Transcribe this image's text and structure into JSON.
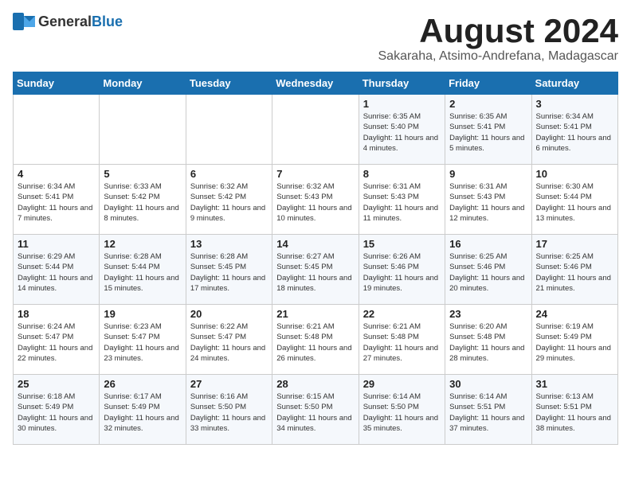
{
  "header": {
    "logo_general": "General",
    "logo_blue": "Blue",
    "title": "August 2024",
    "subtitle": "Sakaraha, Atsimo-Andrefana, Madagascar"
  },
  "days_of_week": [
    "Sunday",
    "Monday",
    "Tuesday",
    "Wednesday",
    "Thursday",
    "Friday",
    "Saturday"
  ],
  "weeks": [
    [
      {
        "day": "",
        "info": ""
      },
      {
        "day": "",
        "info": ""
      },
      {
        "day": "",
        "info": ""
      },
      {
        "day": "",
        "info": ""
      },
      {
        "day": "1",
        "info": "Sunrise: 6:35 AM\nSunset: 5:40 PM\nDaylight: 11 hours and 4 minutes."
      },
      {
        "day": "2",
        "info": "Sunrise: 6:35 AM\nSunset: 5:41 PM\nDaylight: 11 hours and 5 minutes."
      },
      {
        "day": "3",
        "info": "Sunrise: 6:34 AM\nSunset: 5:41 PM\nDaylight: 11 hours and 6 minutes."
      }
    ],
    [
      {
        "day": "4",
        "info": "Sunrise: 6:34 AM\nSunset: 5:41 PM\nDaylight: 11 hours and 7 minutes."
      },
      {
        "day": "5",
        "info": "Sunrise: 6:33 AM\nSunset: 5:42 PM\nDaylight: 11 hours and 8 minutes."
      },
      {
        "day": "6",
        "info": "Sunrise: 6:32 AM\nSunset: 5:42 PM\nDaylight: 11 hours and 9 minutes."
      },
      {
        "day": "7",
        "info": "Sunrise: 6:32 AM\nSunset: 5:43 PM\nDaylight: 11 hours and 10 minutes."
      },
      {
        "day": "8",
        "info": "Sunrise: 6:31 AM\nSunset: 5:43 PM\nDaylight: 11 hours and 11 minutes."
      },
      {
        "day": "9",
        "info": "Sunrise: 6:31 AM\nSunset: 5:43 PM\nDaylight: 11 hours and 12 minutes."
      },
      {
        "day": "10",
        "info": "Sunrise: 6:30 AM\nSunset: 5:44 PM\nDaylight: 11 hours and 13 minutes."
      }
    ],
    [
      {
        "day": "11",
        "info": "Sunrise: 6:29 AM\nSunset: 5:44 PM\nDaylight: 11 hours and 14 minutes."
      },
      {
        "day": "12",
        "info": "Sunrise: 6:28 AM\nSunset: 5:44 PM\nDaylight: 11 hours and 15 minutes."
      },
      {
        "day": "13",
        "info": "Sunrise: 6:28 AM\nSunset: 5:45 PM\nDaylight: 11 hours and 17 minutes."
      },
      {
        "day": "14",
        "info": "Sunrise: 6:27 AM\nSunset: 5:45 PM\nDaylight: 11 hours and 18 minutes."
      },
      {
        "day": "15",
        "info": "Sunrise: 6:26 AM\nSunset: 5:46 PM\nDaylight: 11 hours and 19 minutes."
      },
      {
        "day": "16",
        "info": "Sunrise: 6:25 AM\nSunset: 5:46 PM\nDaylight: 11 hours and 20 minutes."
      },
      {
        "day": "17",
        "info": "Sunrise: 6:25 AM\nSunset: 5:46 PM\nDaylight: 11 hours and 21 minutes."
      }
    ],
    [
      {
        "day": "18",
        "info": "Sunrise: 6:24 AM\nSunset: 5:47 PM\nDaylight: 11 hours and 22 minutes."
      },
      {
        "day": "19",
        "info": "Sunrise: 6:23 AM\nSunset: 5:47 PM\nDaylight: 11 hours and 23 minutes."
      },
      {
        "day": "20",
        "info": "Sunrise: 6:22 AM\nSunset: 5:47 PM\nDaylight: 11 hours and 24 minutes."
      },
      {
        "day": "21",
        "info": "Sunrise: 6:21 AM\nSunset: 5:48 PM\nDaylight: 11 hours and 26 minutes."
      },
      {
        "day": "22",
        "info": "Sunrise: 6:21 AM\nSunset: 5:48 PM\nDaylight: 11 hours and 27 minutes."
      },
      {
        "day": "23",
        "info": "Sunrise: 6:20 AM\nSunset: 5:48 PM\nDaylight: 11 hours and 28 minutes."
      },
      {
        "day": "24",
        "info": "Sunrise: 6:19 AM\nSunset: 5:49 PM\nDaylight: 11 hours and 29 minutes."
      }
    ],
    [
      {
        "day": "25",
        "info": "Sunrise: 6:18 AM\nSunset: 5:49 PM\nDaylight: 11 hours and 30 minutes."
      },
      {
        "day": "26",
        "info": "Sunrise: 6:17 AM\nSunset: 5:49 PM\nDaylight: 11 hours and 32 minutes."
      },
      {
        "day": "27",
        "info": "Sunrise: 6:16 AM\nSunset: 5:50 PM\nDaylight: 11 hours and 33 minutes."
      },
      {
        "day": "28",
        "info": "Sunrise: 6:15 AM\nSunset: 5:50 PM\nDaylight: 11 hours and 34 minutes."
      },
      {
        "day": "29",
        "info": "Sunrise: 6:14 AM\nSunset: 5:50 PM\nDaylight: 11 hours and 35 minutes."
      },
      {
        "day": "30",
        "info": "Sunrise: 6:14 AM\nSunset: 5:51 PM\nDaylight: 11 hours and 37 minutes."
      },
      {
        "day": "31",
        "info": "Sunrise: 6:13 AM\nSunset: 5:51 PM\nDaylight: 11 hours and 38 minutes."
      }
    ]
  ]
}
